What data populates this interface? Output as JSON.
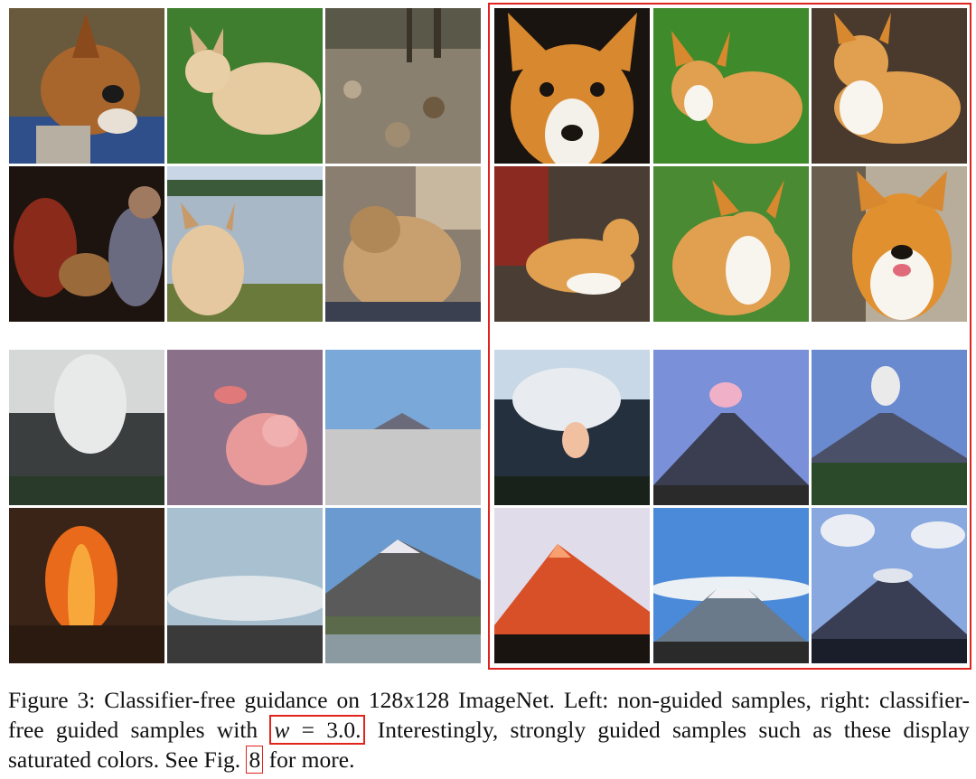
{
  "figure": {
    "caption": {
      "line1": "Figure 3: Classifier-free guidance on 128x128 ImageNet. Left: non-guided samples, right: classifier-",
      "line2_before": "free guided samples with",
      "eq_var": "w",
      "eq_rest": " = 3.0.",
      "line2_after": " Interestingly, strongly guided samples such as these display",
      "line3_before": "saturated colors. See Fig.",
      "fig_ref": "8",
      "line3_after": " for more."
    },
    "colors": {
      "highlight": "#e0231d"
    }
  }
}
